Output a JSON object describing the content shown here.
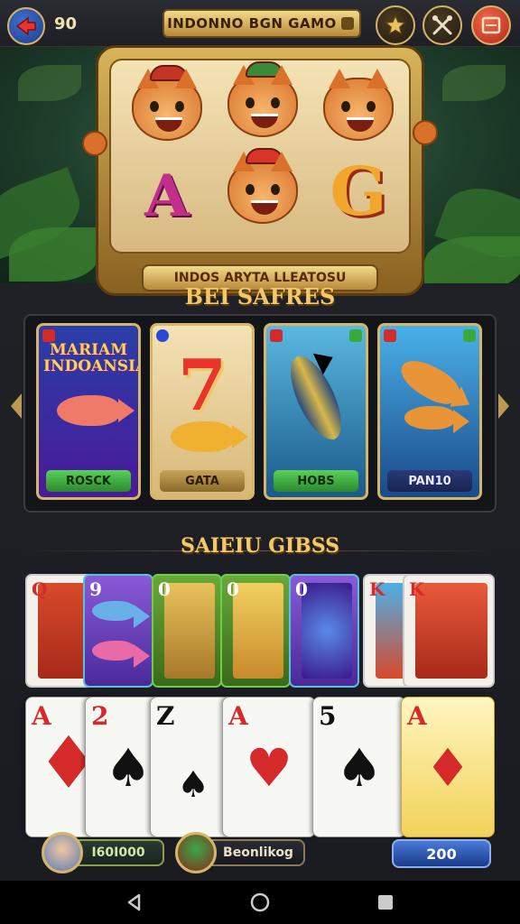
{
  "topbar": {
    "coin_count": "90",
    "title": "INDONNO BGN GAMO",
    "icons": [
      "back-arrow-icon",
      "star-icon",
      "tools-icon",
      "menu-icon"
    ]
  },
  "banner": {
    "title": "INDOS ARYTA LLEATOSU"
  },
  "section1": {
    "title": "BEI SAFRES"
  },
  "tiles": [
    {
      "logo": "MARIAM INDOANSIA",
      "label": "ROSCK",
      "bg": "#2a3ea8"
    },
    {
      "logo": "7",
      "label": "GATA",
      "bg": "#e9cf92"
    },
    {
      "logo": "",
      "label": "HOBS",
      "bg": "#2e8ab8"
    },
    {
      "logo": "",
      "label": "PAN10",
      "bg": "#2a70b8"
    }
  ],
  "section2": {
    "title": "SAIEIU GIBSS"
  },
  "small_cards": [
    {
      "rank": "Q",
      "color": "#d42a2a"
    },
    {
      "rank": "9",
      "color": "#222"
    },
    {
      "rank": "0",
      "color": "#222"
    },
    {
      "rank": "0",
      "color": "#222"
    },
    {
      "rank": "0",
      "color": "#222"
    },
    {
      "rank": "K",
      "color": "#d42a2a"
    },
    {
      "rank": "K",
      "color": "#d42a2a"
    }
  ],
  "big_cards": [
    {
      "rank": "A",
      "suit": "♦",
      "color": "#d42a2a"
    },
    {
      "rank": "2",
      "suit": "♠",
      "color": "#111"
    },
    {
      "rank": "Z",
      "suit": "♠",
      "color": "#111"
    },
    {
      "rank": "A",
      "suit": "♥",
      "color": "#d42a2a"
    },
    {
      "rank": "5",
      "suit": "♠",
      "color": "#111"
    },
    {
      "rank": "A",
      "suit": "♦",
      "color": "#d42a2a"
    }
  ],
  "footer": {
    "player1_value": "I60I000",
    "player2_name": "Beonlikog",
    "bet_value": "200"
  },
  "navbar": {
    "icons": [
      "nav-back-icon",
      "nav-home-icon",
      "nav-recents-icon"
    ]
  }
}
